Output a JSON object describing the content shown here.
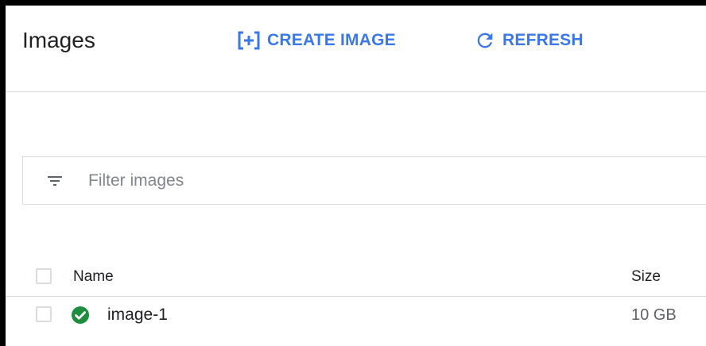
{
  "header": {
    "title": "Images",
    "create_label": "CREATE IMAGE",
    "create_icon": "add-box-icon",
    "refresh_label": "REFRESH",
    "refresh_icon": "refresh-icon",
    "accent_color": "#3b78e7"
  },
  "filter": {
    "icon": "filter-list-icon",
    "placeholder": "Filter images",
    "value": ""
  },
  "table": {
    "columns": [
      "Name",
      "Size"
    ],
    "rows": [
      {
        "name": "image-1",
        "size": "10 GB",
        "status": "ready",
        "status_icon": "check-circle-icon",
        "status_color": "#1e8e3e"
      }
    ]
  }
}
